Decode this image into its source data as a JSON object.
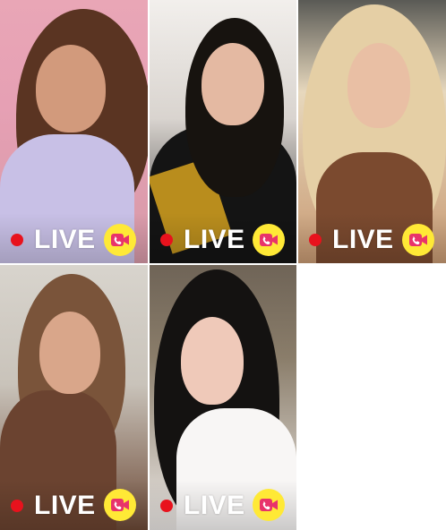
{
  "colors": {
    "live_dot": "#e8121d",
    "call_button_bg": "#ffe936",
    "call_icon": "#e8336b",
    "live_text": "#ffffff"
  },
  "streams": [
    {
      "live_label": "LIVE",
      "status_icon": "red-dot-icon",
      "action_icon": "video-call-icon"
    },
    {
      "live_label": "LIVE",
      "status_icon": "red-dot-icon",
      "action_icon": "video-call-icon"
    },
    {
      "live_label": "LIVE",
      "status_icon": "red-dot-icon",
      "action_icon": "video-call-icon"
    },
    {
      "live_label": "LIVE",
      "status_icon": "red-dot-icon",
      "action_icon": "video-call-icon"
    },
    {
      "live_label": "LIVE",
      "status_icon": "red-dot-icon",
      "action_icon": "video-call-icon"
    }
  ]
}
